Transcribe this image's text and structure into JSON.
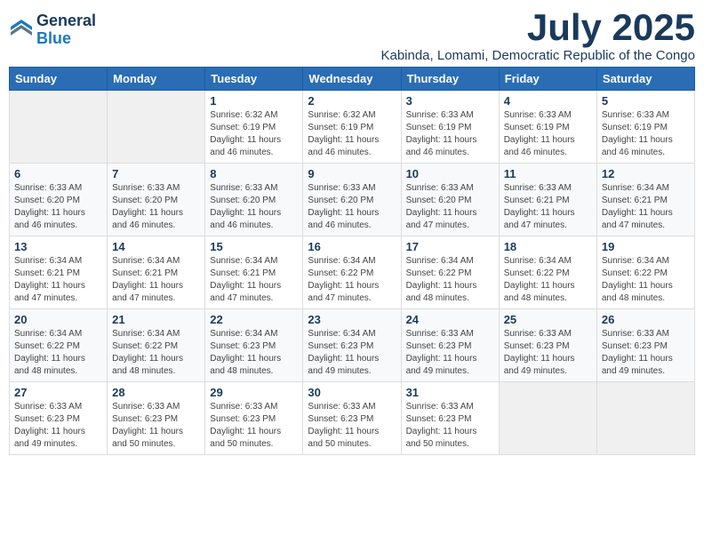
{
  "logo": {
    "line1": "General",
    "line2": "Blue"
  },
  "title": "July 2025",
  "subtitle": "Kabinda, Lomami, Democratic Republic of the Congo",
  "headers": [
    "Sunday",
    "Monday",
    "Tuesday",
    "Wednesday",
    "Thursday",
    "Friday",
    "Saturday"
  ],
  "weeks": [
    [
      {
        "day": "",
        "info": ""
      },
      {
        "day": "",
        "info": ""
      },
      {
        "day": "1",
        "info": "Sunrise: 6:32 AM\nSunset: 6:19 PM\nDaylight: 11 hours and 46 minutes."
      },
      {
        "day": "2",
        "info": "Sunrise: 6:32 AM\nSunset: 6:19 PM\nDaylight: 11 hours and 46 minutes."
      },
      {
        "day": "3",
        "info": "Sunrise: 6:33 AM\nSunset: 6:19 PM\nDaylight: 11 hours and 46 minutes."
      },
      {
        "day": "4",
        "info": "Sunrise: 6:33 AM\nSunset: 6:19 PM\nDaylight: 11 hours and 46 minutes."
      },
      {
        "day": "5",
        "info": "Sunrise: 6:33 AM\nSunset: 6:19 PM\nDaylight: 11 hours and 46 minutes."
      }
    ],
    [
      {
        "day": "6",
        "info": "Sunrise: 6:33 AM\nSunset: 6:20 PM\nDaylight: 11 hours and 46 minutes."
      },
      {
        "day": "7",
        "info": "Sunrise: 6:33 AM\nSunset: 6:20 PM\nDaylight: 11 hours and 46 minutes."
      },
      {
        "day": "8",
        "info": "Sunrise: 6:33 AM\nSunset: 6:20 PM\nDaylight: 11 hours and 46 minutes."
      },
      {
        "day": "9",
        "info": "Sunrise: 6:33 AM\nSunset: 6:20 PM\nDaylight: 11 hours and 46 minutes."
      },
      {
        "day": "10",
        "info": "Sunrise: 6:33 AM\nSunset: 6:20 PM\nDaylight: 11 hours and 47 minutes."
      },
      {
        "day": "11",
        "info": "Sunrise: 6:33 AM\nSunset: 6:21 PM\nDaylight: 11 hours and 47 minutes."
      },
      {
        "day": "12",
        "info": "Sunrise: 6:34 AM\nSunset: 6:21 PM\nDaylight: 11 hours and 47 minutes."
      }
    ],
    [
      {
        "day": "13",
        "info": "Sunrise: 6:34 AM\nSunset: 6:21 PM\nDaylight: 11 hours and 47 minutes."
      },
      {
        "day": "14",
        "info": "Sunrise: 6:34 AM\nSunset: 6:21 PM\nDaylight: 11 hours and 47 minutes."
      },
      {
        "day": "15",
        "info": "Sunrise: 6:34 AM\nSunset: 6:21 PM\nDaylight: 11 hours and 47 minutes."
      },
      {
        "day": "16",
        "info": "Sunrise: 6:34 AM\nSunset: 6:22 PM\nDaylight: 11 hours and 47 minutes."
      },
      {
        "day": "17",
        "info": "Sunrise: 6:34 AM\nSunset: 6:22 PM\nDaylight: 11 hours and 48 minutes."
      },
      {
        "day": "18",
        "info": "Sunrise: 6:34 AM\nSunset: 6:22 PM\nDaylight: 11 hours and 48 minutes."
      },
      {
        "day": "19",
        "info": "Sunrise: 6:34 AM\nSunset: 6:22 PM\nDaylight: 11 hours and 48 minutes."
      }
    ],
    [
      {
        "day": "20",
        "info": "Sunrise: 6:34 AM\nSunset: 6:22 PM\nDaylight: 11 hours and 48 minutes."
      },
      {
        "day": "21",
        "info": "Sunrise: 6:34 AM\nSunset: 6:22 PM\nDaylight: 11 hours and 48 minutes."
      },
      {
        "day": "22",
        "info": "Sunrise: 6:34 AM\nSunset: 6:23 PM\nDaylight: 11 hours and 48 minutes."
      },
      {
        "day": "23",
        "info": "Sunrise: 6:34 AM\nSunset: 6:23 PM\nDaylight: 11 hours and 49 minutes."
      },
      {
        "day": "24",
        "info": "Sunrise: 6:33 AM\nSunset: 6:23 PM\nDaylight: 11 hours and 49 minutes."
      },
      {
        "day": "25",
        "info": "Sunrise: 6:33 AM\nSunset: 6:23 PM\nDaylight: 11 hours and 49 minutes."
      },
      {
        "day": "26",
        "info": "Sunrise: 6:33 AM\nSunset: 6:23 PM\nDaylight: 11 hours and 49 minutes."
      }
    ],
    [
      {
        "day": "27",
        "info": "Sunrise: 6:33 AM\nSunset: 6:23 PM\nDaylight: 11 hours and 49 minutes."
      },
      {
        "day": "28",
        "info": "Sunrise: 6:33 AM\nSunset: 6:23 PM\nDaylight: 11 hours and 50 minutes."
      },
      {
        "day": "29",
        "info": "Sunrise: 6:33 AM\nSunset: 6:23 PM\nDaylight: 11 hours and 50 minutes."
      },
      {
        "day": "30",
        "info": "Sunrise: 6:33 AM\nSunset: 6:23 PM\nDaylight: 11 hours and 50 minutes."
      },
      {
        "day": "31",
        "info": "Sunrise: 6:33 AM\nSunset: 6:23 PM\nDaylight: 11 hours and 50 minutes."
      },
      {
        "day": "",
        "info": ""
      },
      {
        "day": "",
        "info": ""
      }
    ]
  ]
}
